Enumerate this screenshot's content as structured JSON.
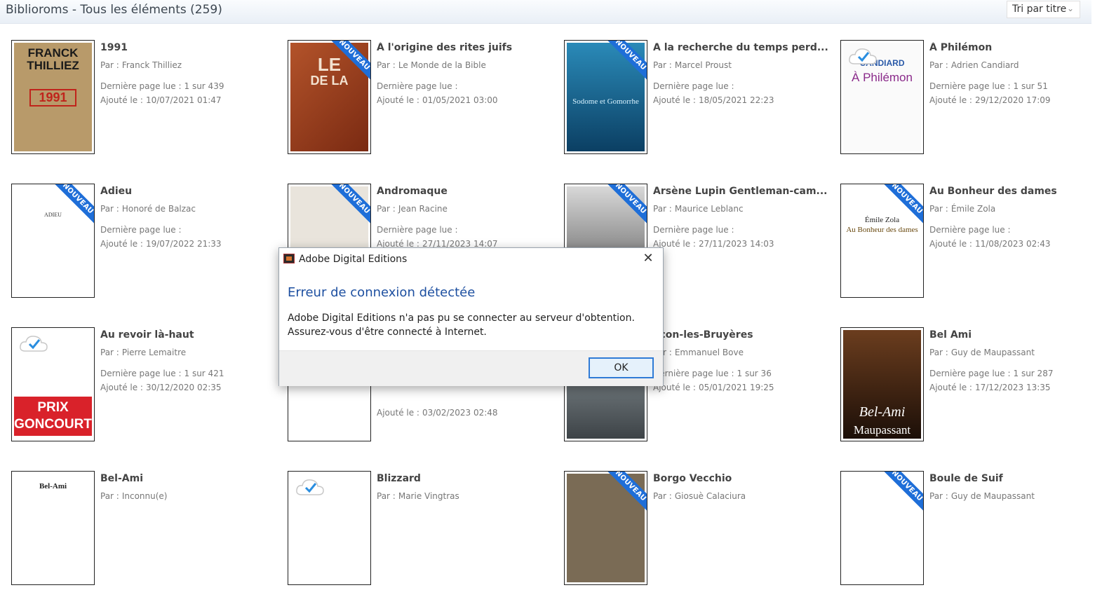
{
  "header": {
    "title": "Biblioroms - Tous les éléments (259)",
    "sort_label": "Tri par titre",
    "sort_icon": "chevron-down-icon"
  },
  "labels": {
    "by": "Par :",
    "last_page": "Dernière page lue :",
    "added": "Ajouté le :",
    "new_ribbon": "NOUVEAU"
  },
  "books": [
    {
      "title": "1991",
      "author": "Franck Thilliez",
      "last_page": "1 sur 439",
      "added": "10/07/2021 01:47",
      "new": false,
      "cover_text": "FRANCK THILLIEZ",
      "cover_sub": "1991"
    },
    {
      "title": "À l'origine des rites juifs",
      "author": "Le Monde de la Bible",
      "last_page": "",
      "added": "01/05/2021 03:00",
      "new": true,
      "cover_text": "LE",
      "cover_sub": "DE LA"
    },
    {
      "title": "A la recherche du temps perd...",
      "author": "Marcel Proust",
      "last_page": "",
      "added": "18/05/2021 22:23",
      "new": true,
      "cover_text": "Sodome et Gomorrhe",
      "cover_sub": ""
    },
    {
      "title": "À Philémon",
      "author": "Adrien Candiard",
      "last_page": "1 sur 51",
      "added": "29/12/2020 17:09",
      "new": false,
      "cover_text": "À Philémon",
      "cover_sub": "CANDIARD"
    },
    {
      "title": "Adieu",
      "author": "Honoré de Balzac",
      "last_page": "",
      "added": "19/07/2022 21:33",
      "new": true,
      "cover_text": "ADIEU",
      "cover_sub": ""
    },
    {
      "title": "Andromaque",
      "author": "Jean Racine",
      "last_page": "",
      "added": "27/11/2023 14:07",
      "new": true,
      "cover_text": "",
      "cover_sub": ""
    },
    {
      "title": "Arsène Lupin Gentleman-cam...",
      "author": "Maurice Leblanc",
      "last_page": "",
      "added": "27/11/2023 14:03",
      "new": true,
      "cover_text": "",
      "cover_sub": ""
    },
    {
      "title": "Au Bonheur des dames",
      "author": "Émile Zola",
      "last_page": "",
      "added": "11/08/2023 02:43",
      "new": true,
      "cover_text": "Au Bonheur des dames",
      "cover_sub": "Émile Zola"
    },
    {
      "title": "Au revoir là-haut",
      "author": "Pierre Lemaitre",
      "last_page": "1 sur 421",
      "added": "30/12/2020 02:35",
      "new": false,
      "cover_text": "PRIX GONCOURT",
      "cover_sub": ""
    },
    {
      "title": "",
      "author": "",
      "last_page": "",
      "added": "03/02/2023 02:48",
      "new": false,
      "cover_text": "",
      "cover_sub": ""
    },
    {
      "title": "écon-les-Bruyères",
      "author": "Emmanuel Bove",
      "last_page": "1 sur 36",
      "added": "05/01/2021 19:25",
      "new": false,
      "cover_text": "",
      "cover_sub": ""
    },
    {
      "title": "Bel Ami",
      "author": "Guy de Maupassant",
      "last_page": "1 sur 287",
      "added": "17/12/2023 13:35",
      "new": false,
      "cover_text": "Bel-Ami",
      "cover_sub": "Maupassant"
    },
    {
      "title": "Bel-Ami",
      "author": "Inconnu(e)",
      "last_page": "",
      "added": "",
      "new": false,
      "cover_text": "Bel-Ami",
      "cover_sub": ""
    },
    {
      "title": "Blizzard",
      "author": "Marie Vingtras",
      "last_page": "",
      "added": "",
      "new": false,
      "cover_text": "",
      "cover_sub": ""
    },
    {
      "title": "Borgo Vecchio",
      "author": "Giosuè Calaciura",
      "last_page": "",
      "added": "",
      "new": true,
      "cover_text": "",
      "cover_sub": ""
    },
    {
      "title": "Boule de Suif",
      "author": "Guy de Maupassant",
      "last_page": "",
      "added": "",
      "new": true,
      "cover_text": "",
      "cover_sub": ""
    }
  ],
  "dialog": {
    "app_title": "Adobe Digital Editions",
    "heading": "Erreur de connexion détectée",
    "line1": "Adobe Digital Editions n'a pas pu se connecter au serveur d'obtention.",
    "line2": "Assurez-vous d'être connecté à Internet.",
    "ok_label": "OK",
    "close_glyph": "✕"
  },
  "colors": {
    "ribbon": "#1e6ed8",
    "dialog_heading": "#1d4fa0",
    "ok_border": "#2f7bd6"
  }
}
